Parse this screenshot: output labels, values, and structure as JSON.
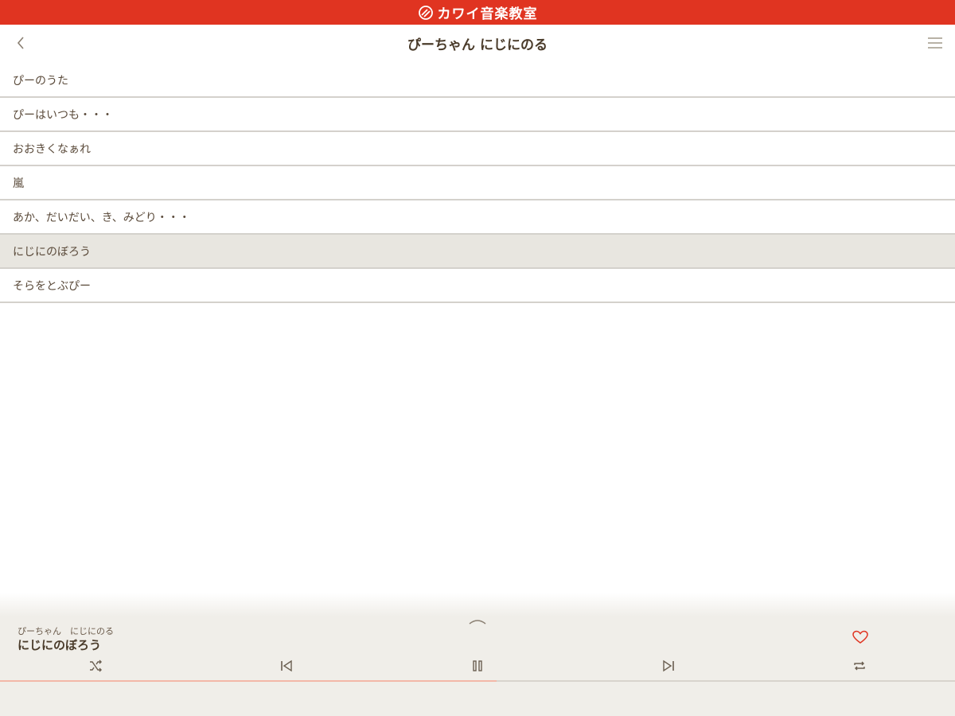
{
  "brand": {
    "name": "カワイ音楽教室",
    "color": "#e03421"
  },
  "nav": {
    "title": "ぴーちゃん にじにのる",
    "back_icon": "chevron-left-icon",
    "menu_icon": "hamburger-menu-icon"
  },
  "tracks": [
    {
      "label": "ぴーのうた",
      "selected": false
    },
    {
      "label": "ぴーはいつも・・・",
      "selected": false
    },
    {
      "label": "おおきくなぁれ",
      "selected": false
    },
    {
      "label": "嵐",
      "selected": false
    },
    {
      "label": "あか、だいだい、き、みどり・・・",
      "selected": false
    },
    {
      "label": "にじにのぼろう",
      "selected": true
    },
    {
      "label": "そらをとぶぴー",
      "selected": false
    }
  ],
  "player": {
    "album": "ぴーちゃん　にじにのる",
    "now_playing": "にじにのぼろう",
    "progress": 0.52,
    "controls": [
      "shuffle-icon",
      "previous-icon",
      "pause-icon",
      "next-icon",
      "repeat-icon"
    ],
    "favorite_color": "#e03421"
  }
}
